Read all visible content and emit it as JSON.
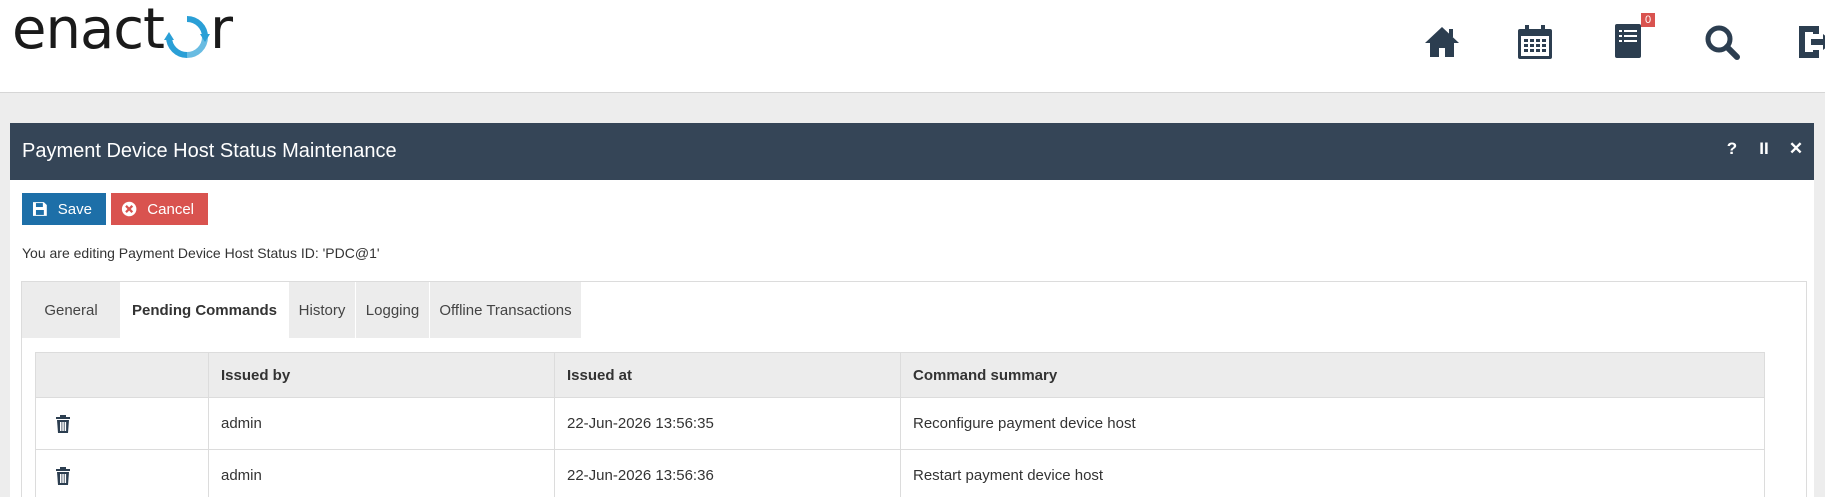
{
  "app": {
    "logo_text_1": "enact",
    "logo_text_2": "r"
  },
  "header_icons": {
    "home": "home-icon",
    "calendar": "calendar-icon",
    "tasks": "tasks-icon",
    "tasks_badge": "0",
    "search": "search-icon",
    "logout": "logout-icon"
  },
  "panel": {
    "title": "Payment Device Host Status Maintenance",
    "help": "?",
    "pause": "II",
    "close": "✕"
  },
  "toolbar": {
    "save_label": "Save",
    "cancel_label": "Cancel"
  },
  "edit_message": "You are editing Payment Device Host Status ID: 'PDC@1'",
  "tabs": [
    {
      "label": "General"
    },
    {
      "label": "Pending Commands"
    },
    {
      "label": "History"
    },
    {
      "label": "Logging"
    },
    {
      "label": "Offline Transactions"
    }
  ],
  "active_tab": "Pending Commands",
  "table": {
    "columns": [
      "",
      "Issued by",
      "Issued at",
      "Command summary"
    ],
    "rows": [
      {
        "issued_by": "admin",
        "issued_at": "22-Jun-2026 13:56:35",
        "summary": "Reconfigure payment device host"
      },
      {
        "issued_by": "admin",
        "issued_at": "22-Jun-2026 13:56:36",
        "summary": "Restart payment device host"
      }
    ]
  },
  "colors": {
    "header_bg": "#354557",
    "save": "#1d6fa8",
    "cancel": "#d9534f",
    "logo_accent": "#2a9fd6"
  }
}
